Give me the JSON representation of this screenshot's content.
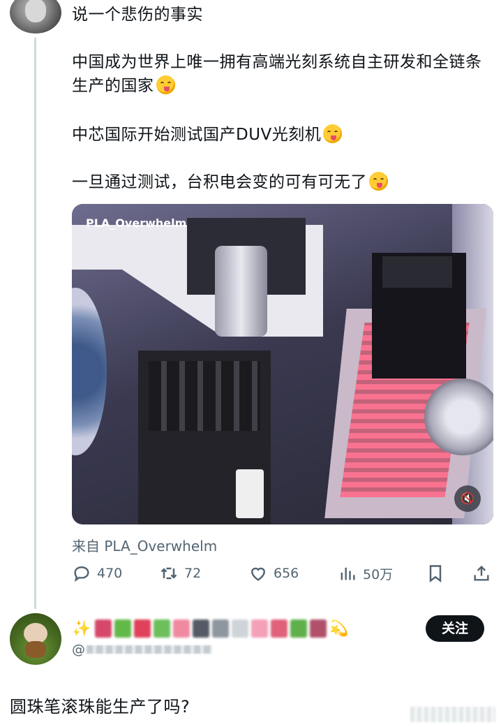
{
  "post": {
    "line1": "说一个悲伤的事实",
    "line2": "中国成为世界上唯一拥有高端光刻系统自主研发和全链条生产的国家",
    "line3": "中芯国际开始测试国产DUV光刻机",
    "line4": "一旦通过测试，台积电会变的可有可无了",
    "emoji_icon": "savoring-food-emoji"
  },
  "video": {
    "watermark": "PLA_Overwhelm",
    "mute_icon": "speaker-muted-icon"
  },
  "source": "来自 PLA_Overwhelm",
  "actions": {
    "replies": "470",
    "retweets": "72",
    "likes": "656",
    "views": "50万"
  },
  "reply": {
    "handle_prefix": "@",
    "follow_label": "关注",
    "text": "圆珠笔滚珠能生产了吗?"
  },
  "colors": {
    "text": "#0f1419",
    "secondary": "#536471",
    "thread_line": "#cfd9de",
    "follow_bg": "#0f1419"
  }
}
